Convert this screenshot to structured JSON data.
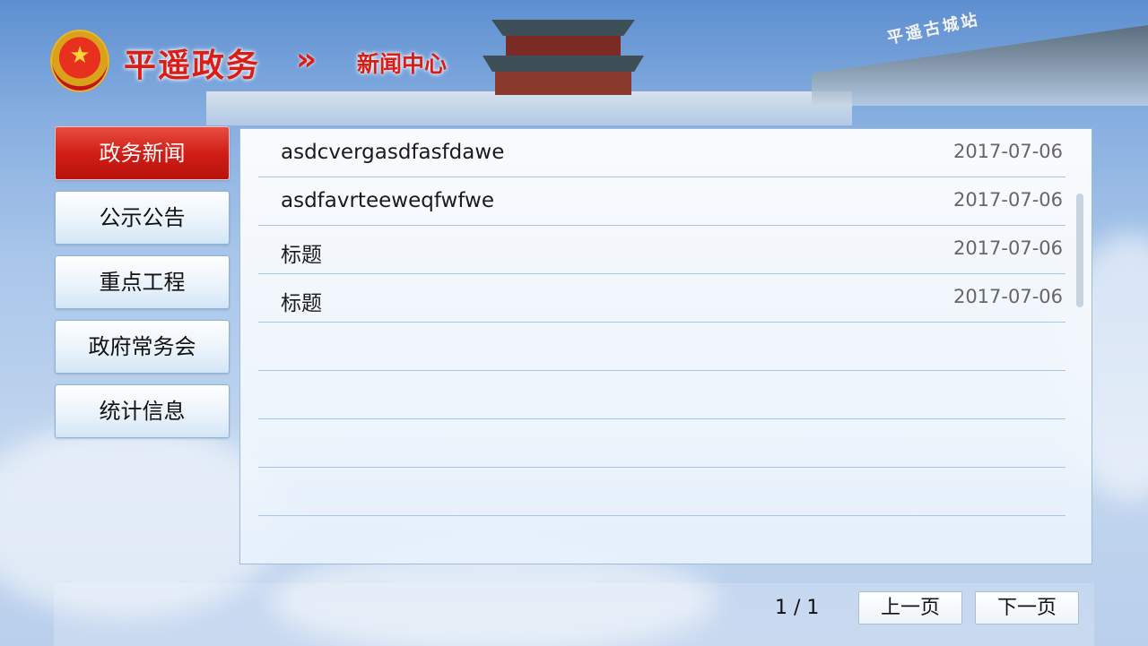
{
  "header": {
    "site_title": "平遥政务",
    "chevron": "»",
    "section_title": "新闻中心",
    "station_name": "平遥古城站",
    "emblem_icon": "national-emblem-icon"
  },
  "sidebar": {
    "items": [
      {
        "label": "政务新闻",
        "active": true
      },
      {
        "label": "公示公告",
        "active": false
      },
      {
        "label": "重点工程",
        "active": false
      },
      {
        "label": "政府常务会",
        "active": false
      },
      {
        "label": "统计信息",
        "active": false
      }
    ]
  },
  "news": {
    "rows": [
      {
        "title": "asdcvergasdfasfdawe",
        "date": "2017-07-06"
      },
      {
        "title": "asdfavrteeweqfwfwe",
        "date": "2017-07-06"
      },
      {
        "title": "标题",
        "date": "2017-07-06"
      },
      {
        "title": "标题",
        "date": "2017-07-06"
      },
      {
        "title": "",
        "date": ""
      },
      {
        "title": "",
        "date": ""
      },
      {
        "title": "",
        "date": ""
      },
      {
        "title": "",
        "date": ""
      }
    ]
  },
  "pagination": {
    "info": "1 / 1",
    "prev_label": "上一页",
    "next_label": "下一页"
  },
  "colors": {
    "accent_red": "#d91e18",
    "active_nav": "#d11e16",
    "row_border": "#a8c6e2"
  }
}
